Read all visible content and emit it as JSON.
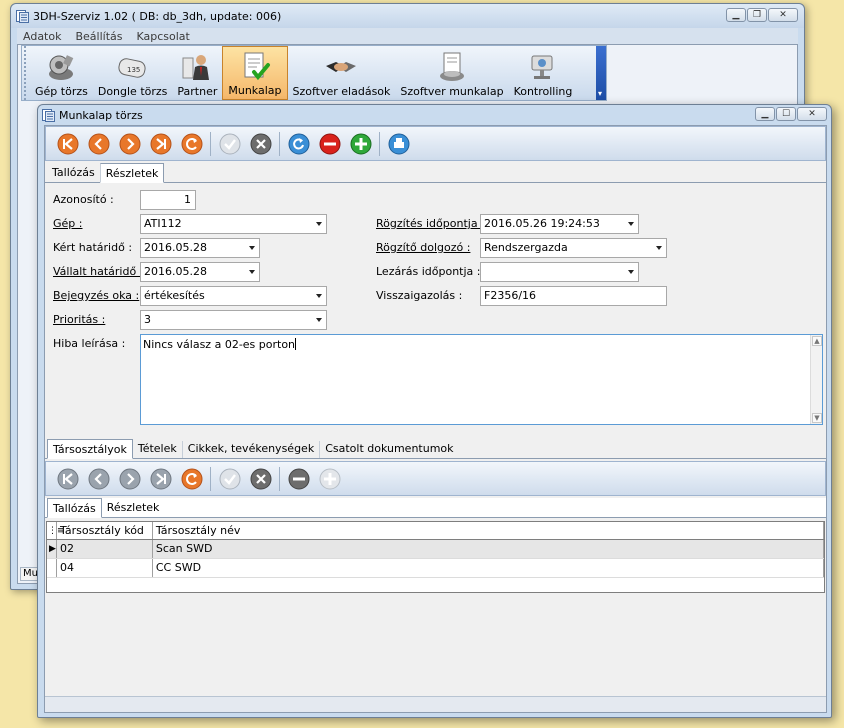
{
  "main_window": {
    "title": "3DH-Szerviz 1.02 ( DB: db_3dh, update: 006)",
    "menu": [
      "Adatok",
      "Beállítás",
      "Kapcsolat"
    ],
    "toolbar": [
      {
        "label": "Gép törzs",
        "icon": "machine-icon"
      },
      {
        "label": "Dongle törzs",
        "icon": "dongle-icon"
      },
      {
        "label": "Partner",
        "icon": "partner-icon"
      },
      {
        "label": "Munkalap",
        "icon": "worksheet-icon",
        "selected": true
      },
      {
        "label": "Szoftver eladások",
        "icon": "handshake-icon"
      },
      {
        "label": "Szoftver munkalap",
        "icon": "software-worksheet-icon"
      },
      {
        "label": "Kontrolling",
        "icon": "controlling-icon"
      }
    ],
    "status_partial": "Mun"
  },
  "child_window": {
    "title": "Munkalap  törzs",
    "nav_buttons": [
      "first",
      "prev",
      "next",
      "last",
      "refresh",
      "post",
      "cancel",
      "reload",
      "delete",
      "add",
      "print"
    ],
    "tabs": [
      "Tallózás",
      "Részletek"
    ],
    "active_tab": "Részletek",
    "form": {
      "azonosito_label": "Azonosító :",
      "azonosito_value": "1",
      "gep_label": "Gép :",
      "gep_value": "ATI112",
      "kert_hatarido_label": "Kért határidő :",
      "kert_hatarido_value": "2016.05.28",
      "vallalt_hatarido_label": "Vállalt határidő :",
      "vallalt_hatarido_value": "2016.05.28",
      "bejegyzes_oka_label": "Bejegyzés oka :",
      "bejegyzes_oka_value": "értékesítés",
      "prioritas_label": "Prioritás :",
      "prioritas_value": "3",
      "hiba_leirasa_label": "Hiba leírása :",
      "hiba_leirasa_value": "Nincs válasz a 02-es porton",
      "rogzites_idopontja_label": "Rögzítés időpontja :",
      "rogzites_idopontja_value": "2016.05.26 19:24:53",
      "rogzito_dolgozo_label": "Rögzítő dolgozó :",
      "rogzito_dolgozo_value": "Rendszergazda",
      "lezaras_idopontja_label": "Lezárás időpontja :",
      "lezaras_idopontja_value": "",
      "visszaigazolas_label": "Visszaigazolás :",
      "visszaigazolas_value": "F2356/16"
    },
    "detail_tabs": [
      "Társosztályok",
      "Tételek",
      "Cikkek, tevékenységek",
      "Csatolt dokumentumok"
    ],
    "active_detail_tab": "Társosztályok",
    "sub_tabs": [
      "Tallózás",
      "Részletek"
    ],
    "active_sub_tab": "Tallózás",
    "grid": {
      "columns": [
        "Társosztály kód",
        "Társosztály név"
      ],
      "rows": [
        [
          "02",
          "Scan SWD"
        ],
        [
          "04",
          "CC SWD"
        ]
      ]
    }
  },
  "colors": {
    "desktop": "#f5e6a8",
    "window_frame": "#c9dbee",
    "nav_orange": "#e8772a",
    "nav_disabled": "#9aa3ad",
    "delete_red": "#d9221c",
    "add_green": "#2fa83a",
    "refresh_blue": "#3a8fd6"
  }
}
